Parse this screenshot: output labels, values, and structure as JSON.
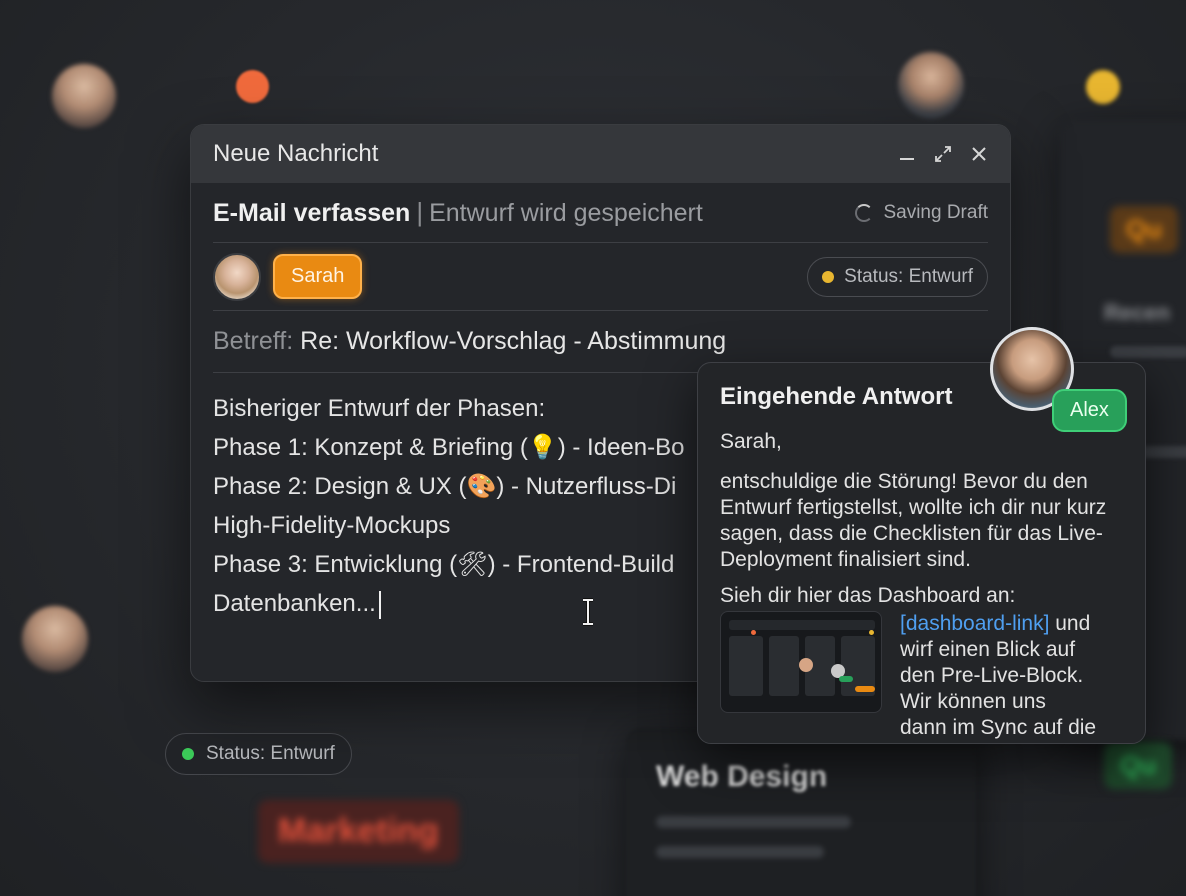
{
  "compose": {
    "window_title": "Neue Nachricht",
    "heading": "E-Mail verfassen",
    "heading_separator": "|",
    "heading_subtitle": "Entwurf wird gespeichert",
    "saving_status": "Saving Draft",
    "recipient": "Sarah",
    "status_label": "Status: Entwurf",
    "status_color": "#e8b630",
    "subject_label": "Betreff:",
    "subject_value": "Re: Workflow-Vorschlag - Abstimmung",
    "body_lines": [
      "Bisheriger Entwurf der Phasen:",
      "Phase 1: Konzept & Briefing (💡) - Ideen-Bo",
      "Phase 2: Design & UX (🎨) - Nutzerfluss-Di",
      "High-Fidelity-Mockups",
      "Phase 3: Entwicklung (🛠) - Frontend-Build",
      "Datenbanken..."
    ]
  },
  "reply": {
    "title": "Eingehende Antwort",
    "sender_chip": "Alex",
    "greeting": "Sarah,",
    "paragraph": "entschuldige die Störung! Bevor du den Entwurf fertigstellst, wollte ich dir nur kurz sagen, dass die Checklisten für das Live-Deployment finalisiert sind.",
    "dashboard_intro": "Sieh dir hier das Dashboard an:",
    "link_text": "[dashboard-link]",
    "after_link_lines": [
      " und",
      "wirf einen Blick auf",
      "den Pre-Live-Block.",
      "Wir können uns",
      "dann im Sync auf die"
    ]
  },
  "background": {
    "status_label": "Status: Entwurf",
    "status_color": "#3ccc5a",
    "tag_marketing": "Marketing",
    "card_title": "Web Design",
    "tag_right_top": "Qu",
    "tag_right_bottom": "Qu",
    "right_panel_label": "Recen",
    "accent_orange": "#f06a3c",
    "accent_yellow": "#e8b630"
  }
}
